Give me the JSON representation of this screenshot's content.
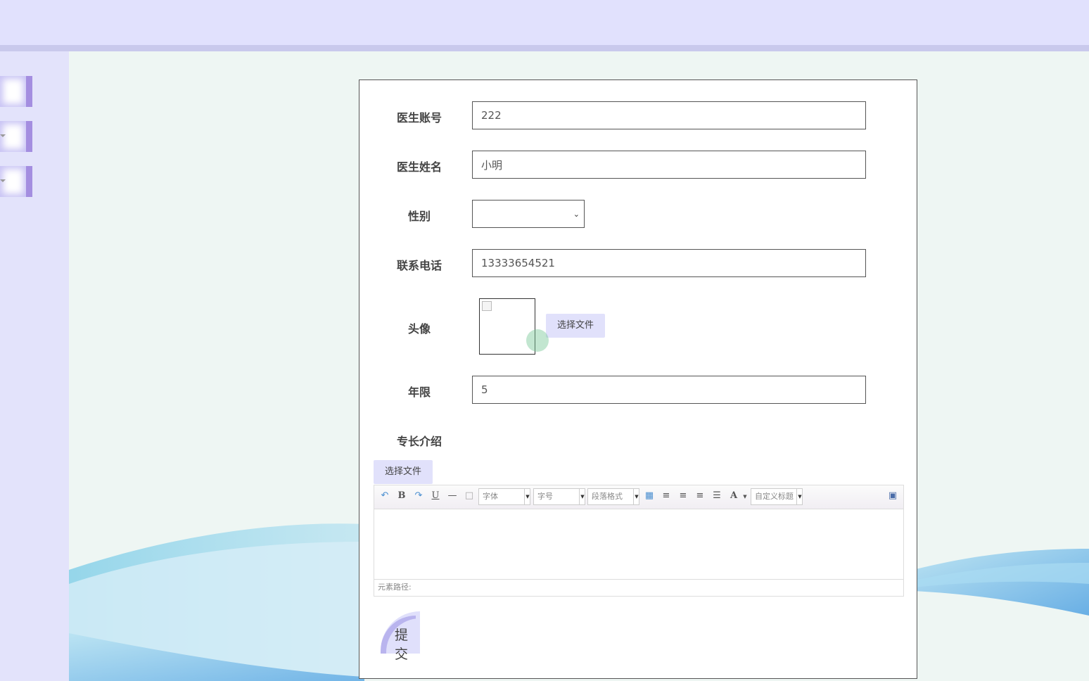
{
  "form": {
    "account_label": "医生账号",
    "account_value": "222",
    "name_label": "医生姓名",
    "name_value": "小明",
    "gender_label": "性别",
    "gender_value": "",
    "phone_label": "联系电话",
    "phone_value": "13333654521",
    "avatar_label": "头像",
    "avatar_file_button": "选择文件",
    "years_label": "年限",
    "years_value": "5",
    "intro_label": "专长介绍",
    "intro_file_button": "选择文件",
    "submit_label": "提交"
  },
  "editor": {
    "font_select": "字体",
    "size_select": "字号",
    "paragraph_select": "段落格式",
    "custom_title_select": "自定义标题",
    "element_path": "元素路径:",
    "icons": [
      "undo-icon",
      "bold-icon",
      "redo-icon",
      "underline-icon",
      "horizontal-rule-icon",
      "document-icon",
      "table-icon",
      "align-left-icon",
      "align-right-icon",
      "align-center-icon",
      "justify-icon",
      "font-color-icon",
      "fullscreen-icon"
    ]
  },
  "colors": {
    "topbar": "#e1e1fd",
    "sidebar": "#e3e3fb",
    "accent": "#a48ee0",
    "button": "#e1e1fb"
  }
}
